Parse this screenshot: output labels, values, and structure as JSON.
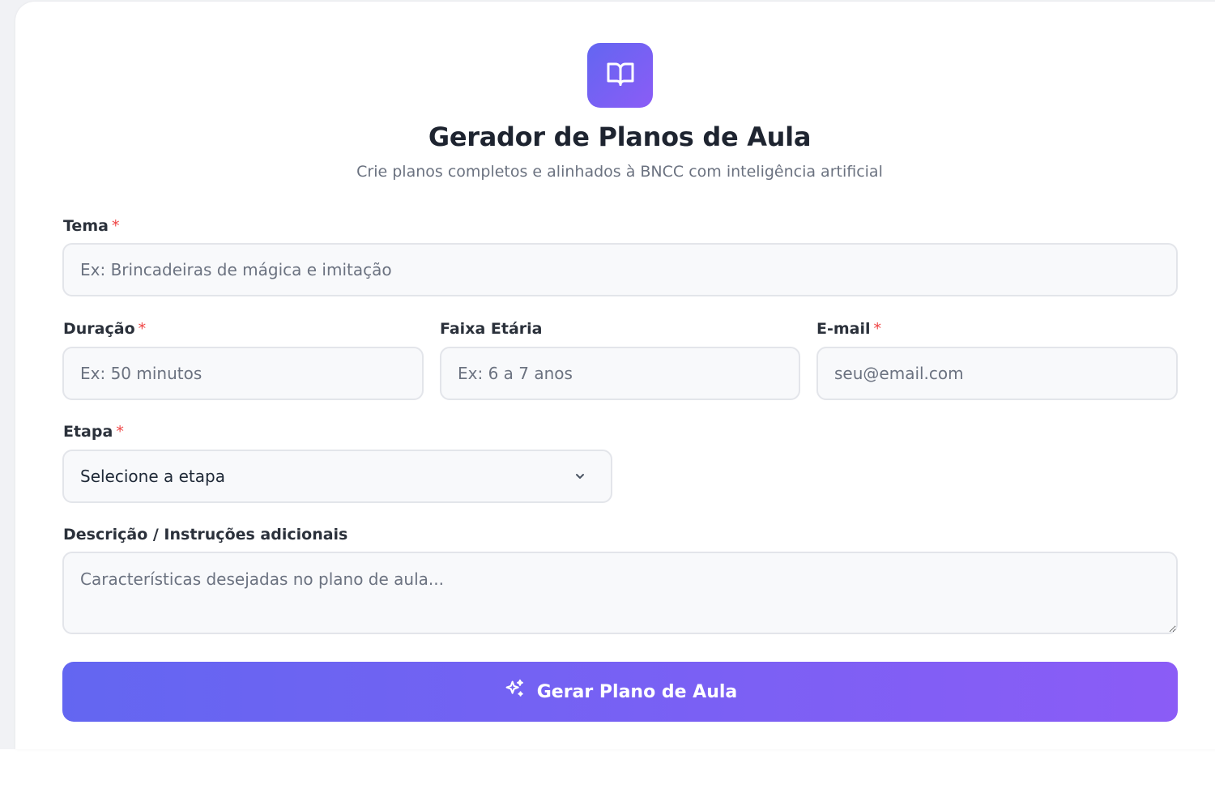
{
  "header": {
    "logo_icon": "book-open-icon",
    "title": "Gerador de Planos de Aula",
    "subtitle": "Crie planos completos e alinhados à BNCC com inteligência artificial"
  },
  "form": {
    "required_mark": "*",
    "tema": {
      "label": "Tema",
      "required": true,
      "placeholder": "Ex: Brincadeiras de mágica e imitação",
      "value": ""
    },
    "duracao": {
      "label": "Duração",
      "required": true,
      "placeholder": "Ex: 50 minutos",
      "value": ""
    },
    "faixa_etaria": {
      "label": "Faixa Etária",
      "required": false,
      "placeholder": "Ex: 6 a 7 anos",
      "value": ""
    },
    "email": {
      "label": "E-mail",
      "required": true,
      "placeholder": "seu@email.com",
      "value": ""
    },
    "etapa": {
      "label": "Etapa",
      "required": true,
      "selected": "Selecione a etapa",
      "icon": "chevron-down-icon"
    },
    "descricao": {
      "label": "Descrição / Instruções adicionais",
      "required": false,
      "placeholder": "Características desejadas no plano de aula...",
      "value": ""
    },
    "submit": {
      "label": "Gerar Plano de Aula",
      "icon": "sparkles-icon"
    }
  },
  "colors": {
    "accent_start": "#6366f1",
    "accent_end": "#8b5cf6",
    "required": "#ef4444"
  }
}
